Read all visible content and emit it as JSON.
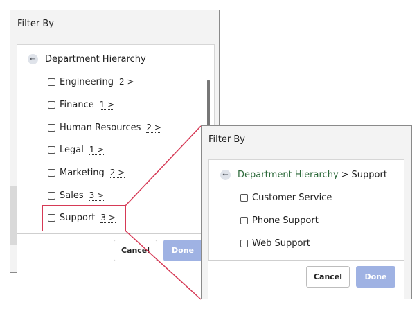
{
  "back_panel": {
    "title": "Filter By",
    "breadcrumb": "Department Hierarchy",
    "items": [
      {
        "label": "Engineering",
        "count": "2 >"
      },
      {
        "label": "Finance",
        "count": "1 >"
      },
      {
        "label": "Human Resources",
        "count": "2 >"
      },
      {
        "label": "Legal",
        "count": "1 >"
      },
      {
        "label": "Marketing",
        "count": "2 >"
      },
      {
        "label": "Sales",
        "count": "3 >"
      },
      {
        "label": "Support",
        "count": "3 >"
      }
    ],
    "cancel": "Cancel",
    "done": "Done"
  },
  "front_panel": {
    "title": "Filter By",
    "breadcrumb_parent": "Department Hierarchy",
    "breadcrumb_separator": ">",
    "breadcrumb_current": "Support",
    "items": [
      {
        "label": "Customer Service"
      },
      {
        "label": "Phone Support"
      },
      {
        "label": "Web Support"
      }
    ],
    "cancel": "Cancel",
    "done": "Done"
  },
  "colors": {
    "highlight": "#d63a56",
    "done_button": "#9fb2e3",
    "breadcrumb_link": "#2d6a3b"
  }
}
